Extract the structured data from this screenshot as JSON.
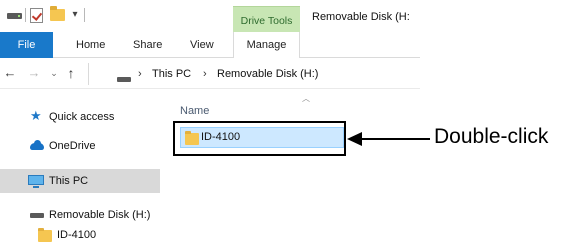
{
  "window": {
    "title": "Removable Disk (H:",
    "contextual_tab_group": "Drive Tools"
  },
  "ribbon": {
    "tabs": [
      {
        "label": "File"
      },
      {
        "label": "Home"
      },
      {
        "label": "Share"
      },
      {
        "label": "View"
      },
      {
        "label": "Manage"
      }
    ]
  },
  "address": {
    "segments": [
      "This PC",
      "Removable Disk (H:)"
    ]
  },
  "navigation_pane": {
    "items": [
      {
        "label": "Quick access",
        "icon": "star-icon"
      },
      {
        "label": "OneDrive",
        "icon": "cloud-icon"
      },
      {
        "label": "This PC",
        "icon": "computer-icon",
        "selected": true
      },
      {
        "label": "Removable Disk (H:)",
        "icon": "drive-icon"
      },
      {
        "label": "ID-4100",
        "icon": "folder-icon"
      }
    ]
  },
  "content": {
    "column_header": "Name",
    "files": [
      {
        "name": "ID-4100",
        "icon": "folder-icon",
        "selected": true
      }
    ]
  },
  "annotation": {
    "text": "Double-click"
  },
  "colors": {
    "file_tab": "#1979ca",
    "drive_tools_tab": "#c8e6b4",
    "selection": "#cde8ff",
    "nav_selected": "#d9d9d9",
    "folder": "#f5c651"
  }
}
